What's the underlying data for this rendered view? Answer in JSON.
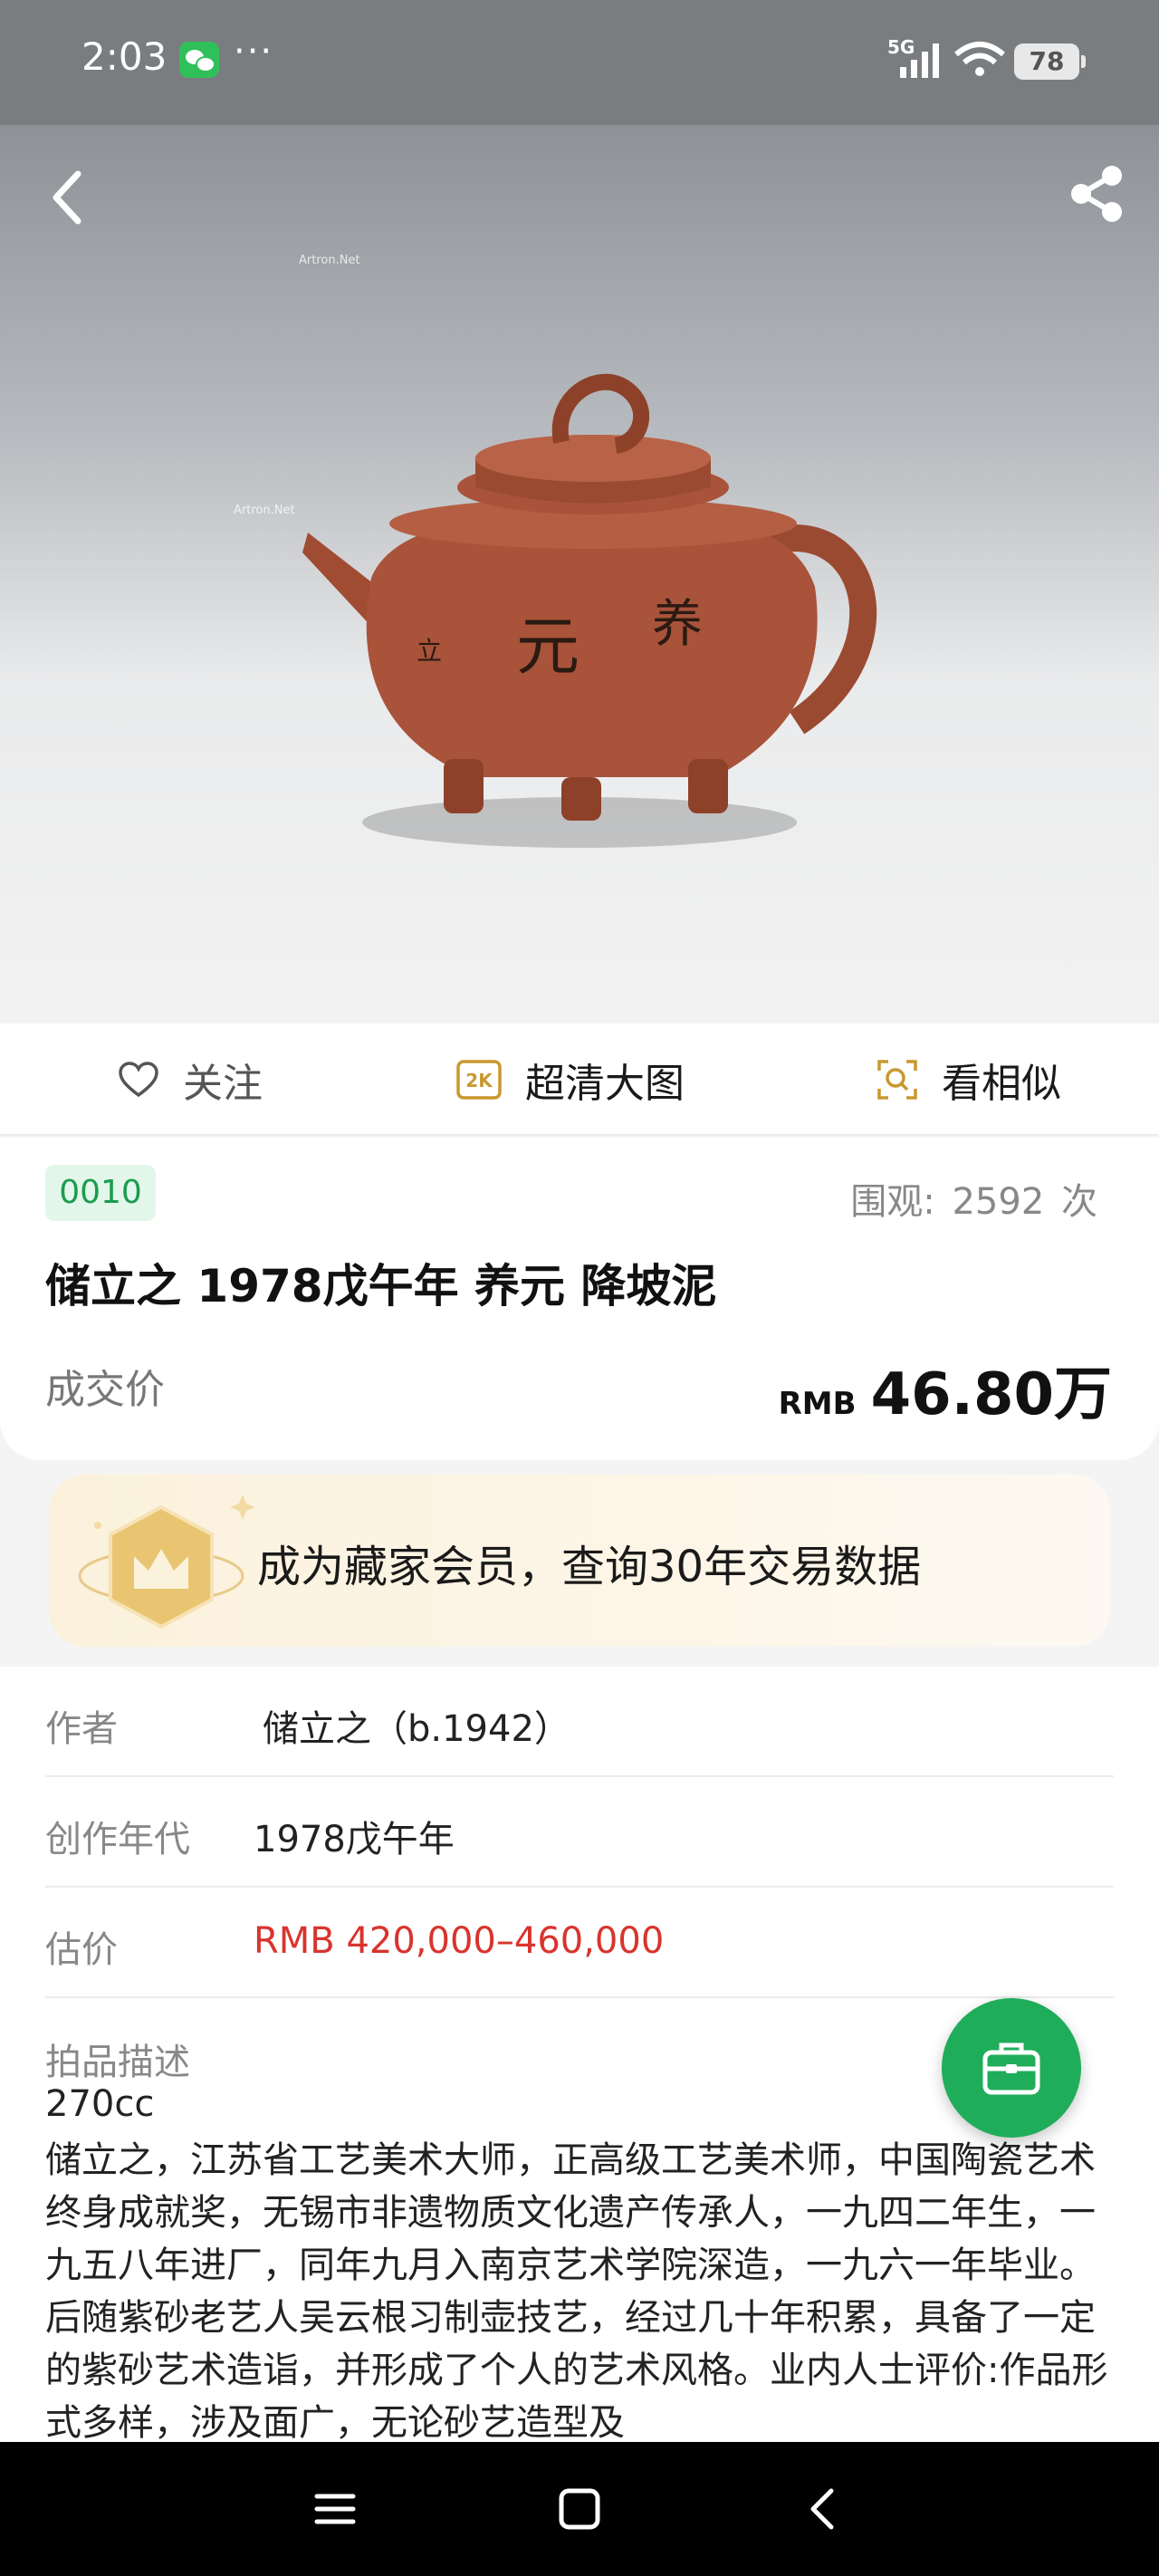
{
  "status_bar": {
    "time": "2:03",
    "dots": "···",
    "network": "5G",
    "battery": "78"
  },
  "hero": {
    "watermark": "Artron.Net"
  },
  "actions": {
    "follow_label": "关注",
    "hd_label": "超清大图",
    "hd_badge": "2K",
    "similar_label": "看相似"
  },
  "lot": {
    "number": "0010",
    "views_label": "围观:",
    "views_count": "2592",
    "views_unit": "次",
    "title": "储立之 1978戊午年 养元 降坡泥",
    "deal_label": "成交价",
    "price_currency": "RMB",
    "price_value": "46.80万"
  },
  "member_banner": {
    "text": "成为藏家会员，查询30年交易数据"
  },
  "details": {
    "author_label": "作者",
    "author_value": "储立之（b.1942）",
    "year_label": "创作年代",
    "year_value": "1978戊午年",
    "estimate_label": "估价",
    "estimate_value": "RMB  420,000–460,000",
    "desc_label": "拍品描述",
    "desc_capacity": "270cc",
    "desc_text": "储立之，江苏省工艺美术大师，正高级工艺美术师，中国陶瓷艺术终身成就奖，无锡市非遗物质文化遗产传承人，一九四二年生，一九五八年进厂，同年九月入南京艺术学院深造，一九六一年毕业。后随紫砂老艺人吴云根习制壶技艺，经过几十年积累，具备了一定的紫砂艺术造诣，并形成了个人的艺术风格。业内人士评价:作品形式多样，涉及面广，无论砂艺造型及"
  },
  "colors": {
    "accent_green": "#1fad5a",
    "estimate_red": "#d8342d",
    "badge_bg": "#e3f6ea"
  },
  "icons": [
    "back-icon",
    "share-icon",
    "heart-icon",
    "hd-icon",
    "similar-search-icon",
    "crown-icon",
    "briefcase-icon",
    "menu-icon",
    "home-icon",
    "nav-back-icon"
  ]
}
